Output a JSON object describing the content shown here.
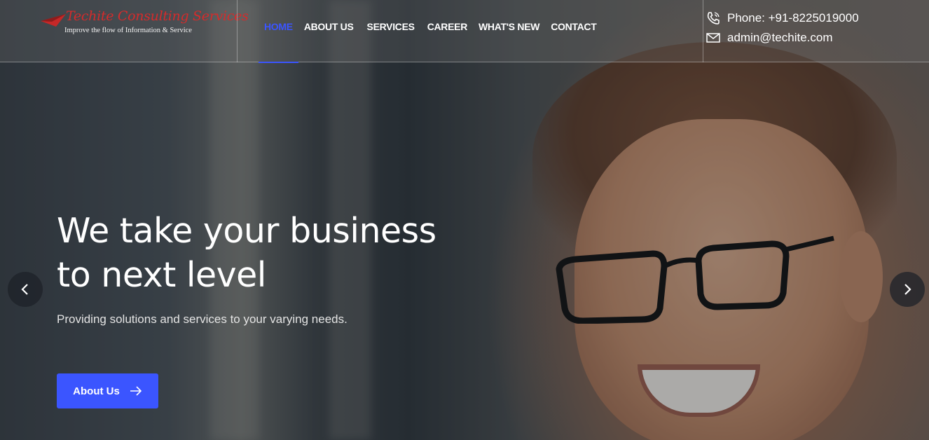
{
  "brand": {
    "name": "Techite Consulting Services",
    "tagline": "Improve the flow of Information & Service",
    "accent_color": "#d52b2b"
  },
  "nav": {
    "items": [
      {
        "label": "HOME",
        "active": true
      },
      {
        "label": "ABOUT US",
        "active": false
      },
      {
        "label": "SERVICES",
        "active": false
      },
      {
        "label": "CAREER",
        "active": false
      },
      {
        "label": "WHAT'S NEW",
        "active": false
      },
      {
        "label": "CONTACT",
        "active": false
      }
    ],
    "active_color": "#3b55ff"
  },
  "contact": {
    "phone": "Phone: +91-8225019000",
    "phone_icon": "phone-icon",
    "email": "admin@techite.com",
    "email_icon": "mail-icon"
  },
  "hero": {
    "title_line1": "We take your business",
    "title_line2": "to next level",
    "subtitle": "Providing solutions and services to your varying needs.",
    "cta_label": "About Us",
    "cta_icon": "arrow-right-icon",
    "prev_icon": "chevron-left-icon",
    "next_icon": "chevron-right-icon"
  }
}
